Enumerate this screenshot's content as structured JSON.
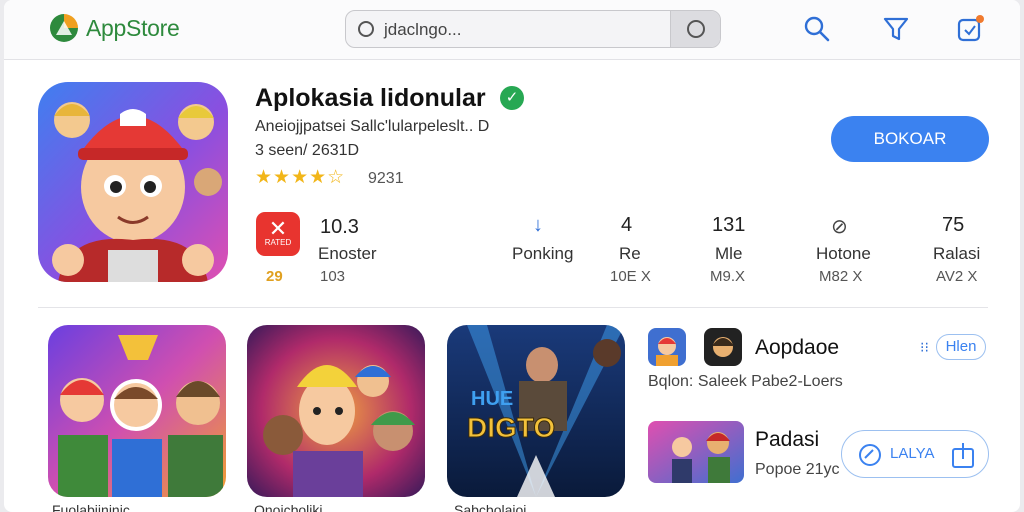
{
  "header": {
    "brand": "AppStore",
    "search_value": "jdaclngo...",
    "icons": [
      "search-icon",
      "filter-icon",
      "notifications-icon"
    ],
    "accent": "#3b82f0",
    "brand_color": "#2e8a3d"
  },
  "app": {
    "title": "Aplokasia lidonular",
    "verified_icon": "check-icon",
    "subtitle": "Aneiojjpatsei Sallc'lularpeleslt.. D",
    "meta": "3 seen/ 2631D",
    "stars": "★★★★☆",
    "rating_count": "9231",
    "install_label": "BOKOAR"
  },
  "stats": {
    "badge_symbol": "✕",
    "badge_sub": "RATED",
    "badge_num": "29",
    "items": [
      {
        "top": "10.3",
        "mid": "Enoster",
        "bottom": "103"
      },
      {
        "top": "↓",
        "mid": "Ponking",
        "bottom": ""
      },
      {
        "top": "4",
        "mid": "Re",
        "bottom": "10E X"
      },
      {
        "top": "131",
        "mid": "Mle",
        "bottom": "M9.X"
      },
      {
        "top": "⊘",
        "mid": "Hotone",
        "bottom": "M82 X"
      },
      {
        "top": "75",
        "mid": "Ralasi",
        "bottom": "AV2 X"
      }
    ]
  },
  "screenshots": {
    "third_text_top": "HUE",
    "third_text_main": "DIGTO",
    "captions": [
      "Fuolabijninic",
      "Onoicboliki",
      "Sabcbolaioi"
    ]
  },
  "side": {
    "item1": {
      "title": "Aopdaoe",
      "subtitle": "Bqlon: Saleek Pabe2-Loers",
      "action": "Hlen"
    },
    "item2": {
      "title": "Padasi",
      "subtitle": "Popoe 21yc",
      "action": "LALYA"
    }
  }
}
